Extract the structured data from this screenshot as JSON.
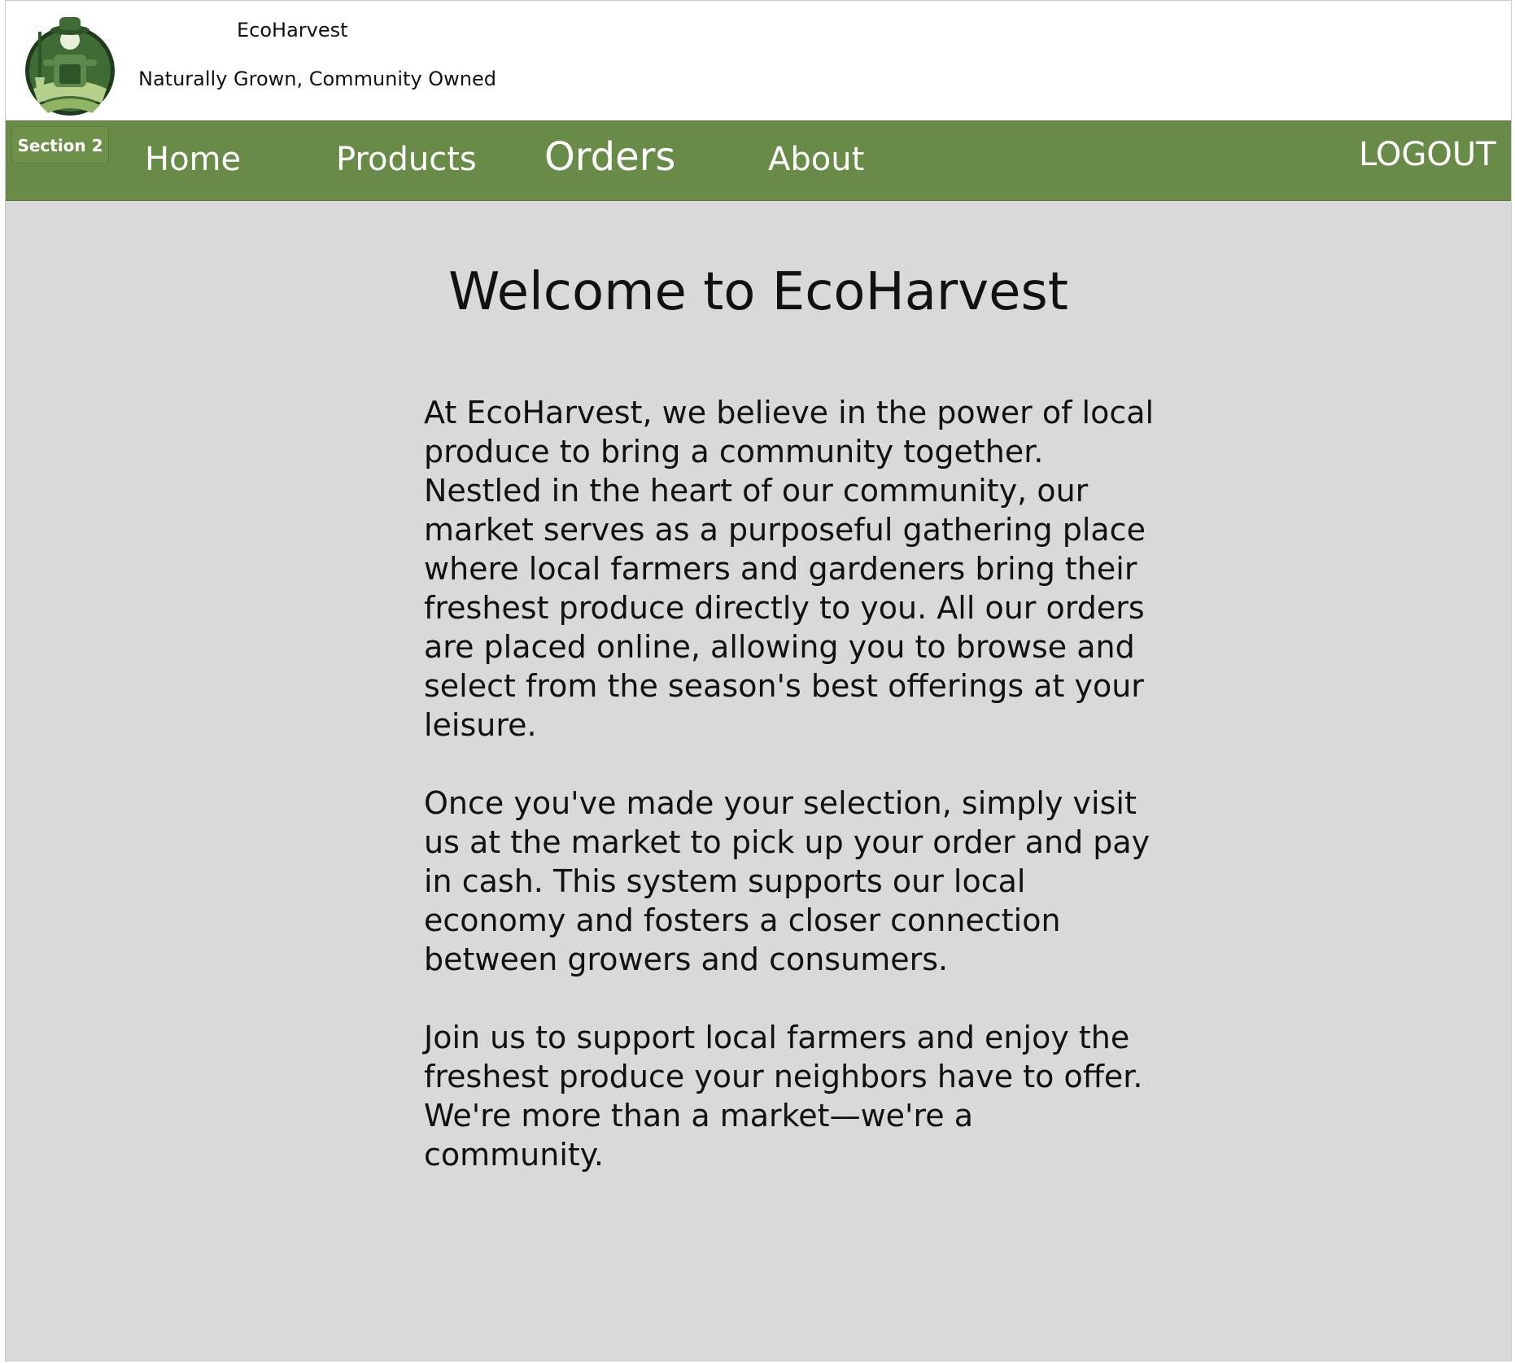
{
  "header": {
    "site_name": "EcoHarvest",
    "tagline": "Naturally Grown, Community Owned",
    "logo_icon": "farmer-logo-icon"
  },
  "nav": {
    "section_badge": "Section 2",
    "items": [
      {
        "label": "Home"
      },
      {
        "label": "Products"
      },
      {
        "label": "Orders"
      },
      {
        "label": "About"
      }
    ],
    "logout_label": "LOGOUT"
  },
  "main": {
    "title": "Welcome to EcoHarvest",
    "paragraphs": [
      "At EcoHarvest, we believe in the power of local produce to bring a community together. Nestled in the heart of our community, our market serves as a purposeful gathering place where local farmers and gardeners bring their freshest produce directly to you. All our orders are placed online, allowing you to browse and select from the season's best offerings at your leisure.",
      "Once you've made your selection, simply visit us at the market to pick up your order and pay in cash. This system supports our local economy and fosters a closer connection between growers and consumers.",
      "Join us to support local farmers and enjoy the freshest produce your neighbors have to offer. We're more than a market—we're a community."
    ]
  },
  "colors": {
    "nav_green": "#688c47",
    "main_background": "#d9d9d9",
    "text": "#111111",
    "logo_dark": "#1f3a1c",
    "logo_light": "#b4d08a"
  }
}
